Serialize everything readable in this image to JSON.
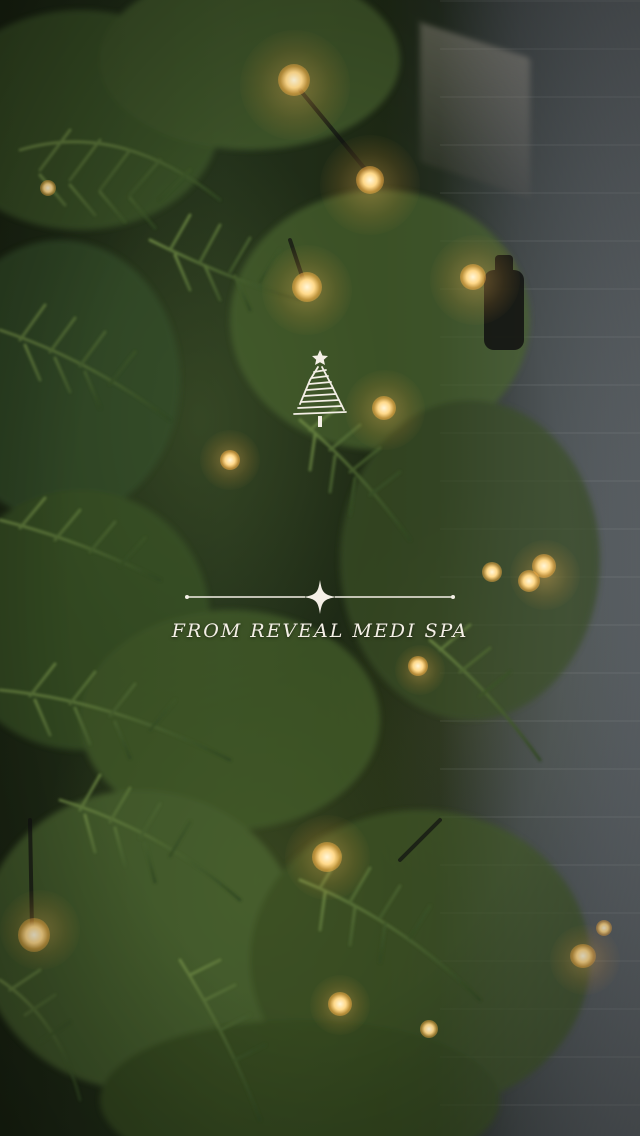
{
  "overlay": {
    "caption": "FROM REVEAL MEDI SPA",
    "icon": "christmas-tree-icon",
    "divider_icon": "sparkle-star-icon",
    "text_color": "#f4efe6"
  },
  "photo": {
    "subject": "christmas-tree-with-lights",
    "light_color": "#ffd98a",
    "foliage_color": "#3d5a2a"
  }
}
